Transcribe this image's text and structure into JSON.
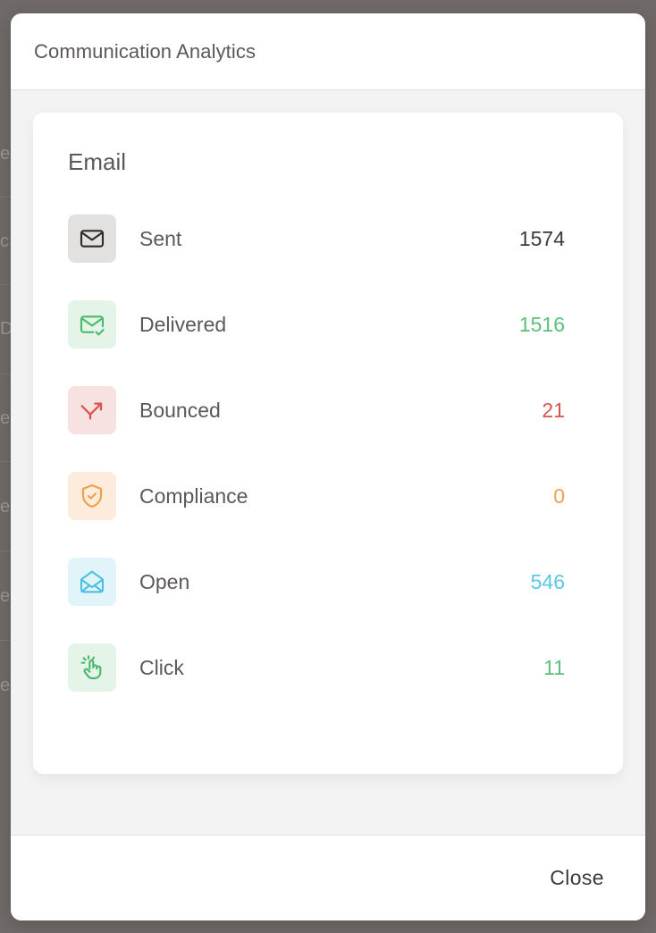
{
  "modal": {
    "title": "Communication Analytics",
    "close_label": "Close"
  },
  "email_card": {
    "title": "Email",
    "stats": [
      {
        "label": "Sent",
        "value": "1574",
        "icon": "mail-icon",
        "color": "#3d3938",
        "bg": "#e2e1e0",
        "stroke": "#2f2b2a"
      },
      {
        "label": "Delivered",
        "value": "1516",
        "icon": "mail-check-icon",
        "color": "#5cc07a",
        "bg": "#e4f4e8",
        "stroke": "#4db86e"
      },
      {
        "label": "Bounced",
        "value": "21",
        "icon": "bounce-arrow-icon",
        "color": "#d9534f",
        "bg": "#f8e1e1",
        "stroke": "#d9534f"
      },
      {
        "label": "Compliance",
        "value": "0",
        "icon": "shield-check-icon",
        "color": "#f0a04b",
        "bg": "#fdebdc",
        "stroke": "#f0a04b"
      },
      {
        "label": "Open",
        "value": "546",
        "icon": "mail-open-icon",
        "color": "#5bc6e6",
        "bg": "#e0f4fa",
        "stroke": "#4ec0e2"
      },
      {
        "label": "Click",
        "value": "11",
        "icon": "pointer-click-icon",
        "color": "#5cc07a",
        "bg": "#e4f4e8",
        "stroke": "#4db86e"
      }
    ]
  }
}
